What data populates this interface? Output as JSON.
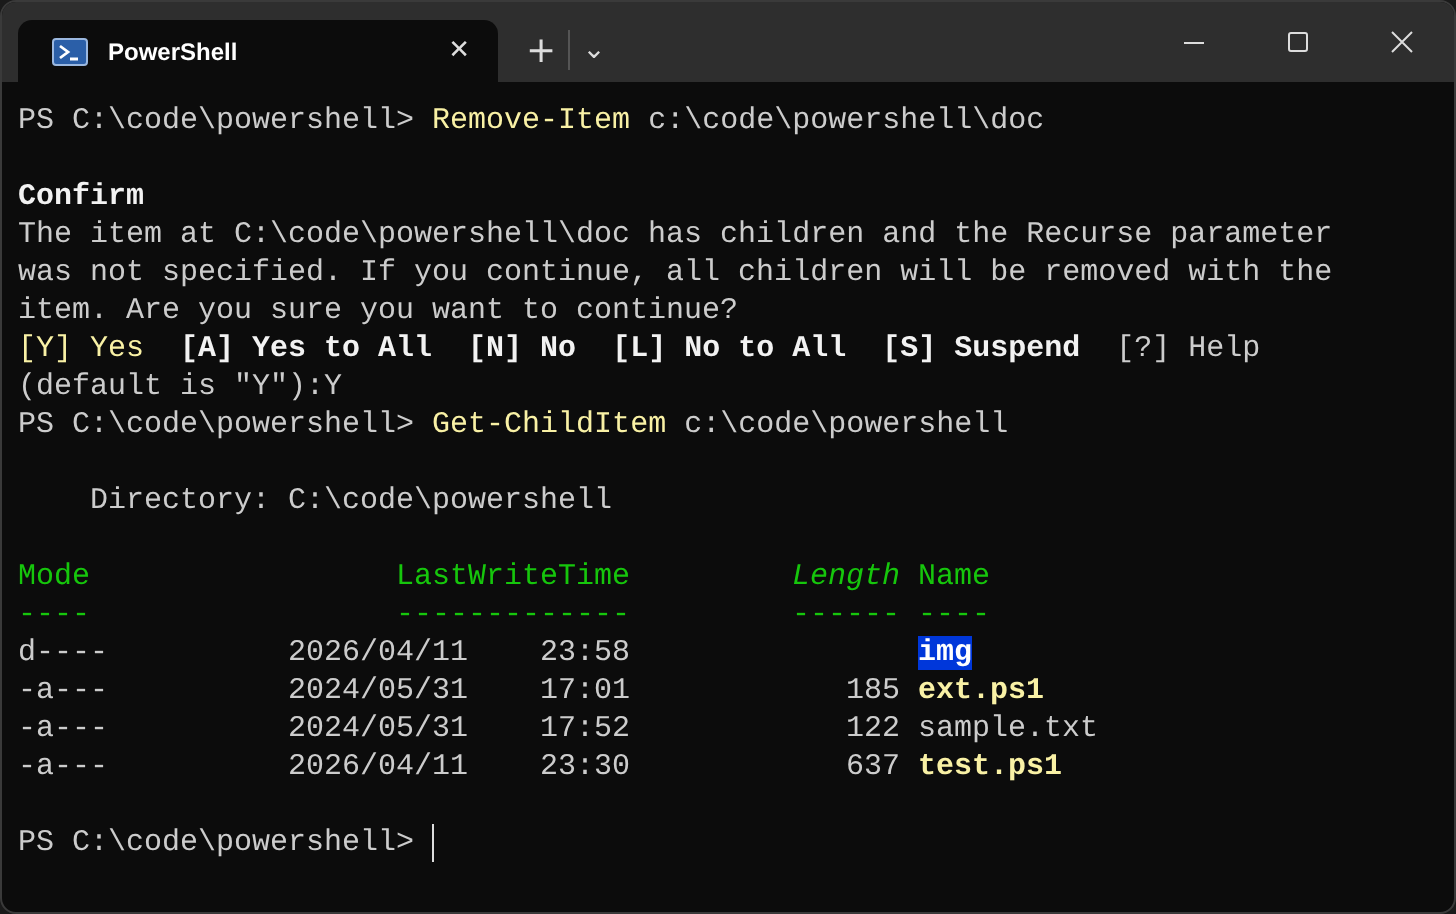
{
  "tab": {
    "title": "PowerShell",
    "close": "✕"
  },
  "tab_actions": {
    "new": "+",
    "dropdown": "⌄"
  },
  "lines": [
    {
      "kind": "command",
      "prompt": "PS C:\\code\\powershell>",
      "command": "Remove-Item",
      "argument": "c:\\code\\powershell\\doc"
    },
    {
      "kind": "blank"
    },
    {
      "kind": "heading",
      "text": "Confirm"
    },
    {
      "kind": "paragraph",
      "lines": [
        "The item at C:\\code\\powershell\\doc has children and the Recurse parameter",
        "was not specified. If you continue, all children will be removed with the",
        "item. Are you sure you want to continue?"
      ]
    },
    {
      "kind": "choices",
      "options": [
        {
          "text": "[Y] Yes",
          "kind": "default"
        },
        {
          "text": "[A] Yes to All",
          "kind": "option"
        },
        {
          "text": "[N] No",
          "kind": "option"
        },
        {
          "text": "[L] No to All",
          "kind": "option"
        },
        {
          "text": "[S] Suspend",
          "kind": "option"
        },
        {
          "text": "[?] Help",
          "kind": "help"
        }
      ]
    },
    {
      "kind": "text",
      "text": "(default is \"Y\"):Y"
    },
    {
      "kind": "command",
      "prompt": "PS C:\\code\\powershell>",
      "command": "Get-ChildItem",
      "argument": "c:\\code\\powershell"
    },
    {
      "kind": "blank"
    },
    {
      "kind": "directory",
      "text": "Directory: C:\\code\\powershell"
    },
    {
      "kind": "blank"
    },
    {
      "kind": "table",
      "columns": [
        "Mode",
        "LastWriteTime",
        "Length",
        "Name"
      ],
      "rules": [
        "----",
        "-------------",
        "------",
        "----"
      ],
      "rows": [
        {
          "mode": "d----",
          "date": "2026/04/11",
          "time": "23:58",
          "length": "",
          "name": "img",
          "kind": "directory"
        },
        {
          "mode": "-a---",
          "date": "2024/05/31",
          "time": "17:01",
          "length": "185",
          "name": "ext.ps1",
          "kind": "script"
        },
        {
          "mode": "-a---",
          "date": "2024/05/31",
          "time": "17:52",
          "length": "122",
          "name": "sample.txt",
          "kind": "file"
        },
        {
          "mode": "-a---",
          "date": "2026/04/11",
          "time": "23:30",
          "length": "637",
          "name": "test.ps1",
          "kind": "script"
        }
      ]
    },
    {
      "kind": "blank"
    },
    {
      "kind": "prompt",
      "prompt": "PS C:\\code\\powershell>",
      "cursor": true
    }
  ]
}
